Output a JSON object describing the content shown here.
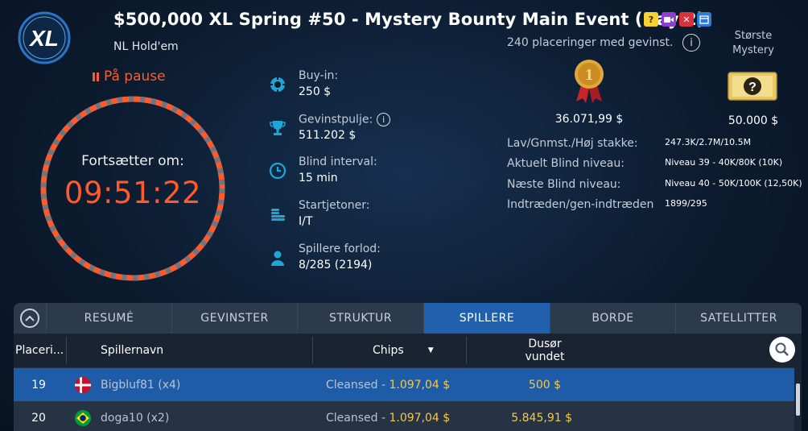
{
  "header": {
    "logo_text": "XL",
    "title": "$500,000 XL Spring #50 - Mystery Bounty Main Event (Day 2)",
    "game_type": "NL Hold'em",
    "badges": [
      {
        "icon": "question-icon",
        "color": "#f3d232"
      },
      {
        "icon": "video-icon",
        "color": "#8c3fd2"
      },
      {
        "icon": "cross-icon",
        "color": "#d9323b"
      },
      {
        "icon": "calendar-icon",
        "color": "#2d7bd6"
      }
    ]
  },
  "status": {
    "label": "På pause",
    "countdown_label": "Fortsætter om:",
    "countdown_value": "09:51:22"
  },
  "info": [
    {
      "icon": "chip-icon",
      "label": "Buy-in:",
      "value": "250 $"
    },
    {
      "icon": "trophy-icon",
      "label": "Gevinstpulje:",
      "value": "511.202 $",
      "has_info": true
    },
    {
      "icon": "clock-icon",
      "label": "Blind interval:",
      "value": "15 min"
    },
    {
      "icon": "chips-stack-icon",
      "label": "Startjetoner:",
      "value": "I/T"
    },
    {
      "icon": "person-icon",
      "label": "Spillere forlod:",
      "value": "8/285 (2194)"
    }
  ],
  "prizes": {
    "places_paid": "240 placeringer med gevinst.",
    "medal_number": "1",
    "first_prize": "36.071,99 $",
    "mystery_label": "Største Mystery",
    "mystery_value": "50.000 $"
  },
  "stats": [
    {
      "label": "Lav/Gnmst./Høj stakke:",
      "value": "247.3K/2.7M/10.5M"
    },
    {
      "label": "Aktuelt Blind niveau:",
      "value": "Niveau 39 - 40K/80K (10K)"
    },
    {
      "label": "Næste Blind niveau:",
      "value": "Niveau 40 - 50K/100K (12,50K)"
    },
    {
      "label": "Indtræden/gen-indtræden",
      "value": "1899/295"
    }
  ],
  "tabs": [
    {
      "label": "RESUMÉ",
      "active": false
    },
    {
      "label": "GEVINSTER",
      "active": false
    },
    {
      "label": "STRUKTUR",
      "active": false
    },
    {
      "label": "SPILLERE",
      "active": true
    },
    {
      "label": "BORDE",
      "active": false
    },
    {
      "label": "SATELLITTER",
      "active": false
    }
  ],
  "table": {
    "columns": [
      "Placeri...",
      "Spillernavn",
      "Chips",
      "Dusør vundet"
    ],
    "rows": [
      {
        "place": "19",
        "flag": "denmark",
        "player": "Bigbluf81 (x4)",
        "chips_status": "Cleansed - ",
        "chips_value": "1.097,04 $",
        "bounty": "500 $",
        "selected": true
      },
      {
        "place": "20",
        "flag": "brazil",
        "player": "doga10 (x2)",
        "chips_status": "Cleansed - ",
        "chips_value": "1.097,04 $",
        "bounty": "5.845,91 $",
        "selected": false
      }
    ]
  },
  "colors": {
    "accent_orange": "#ff5a2c",
    "active_tab": "#2060ad",
    "gold": "#f4c84a"
  }
}
